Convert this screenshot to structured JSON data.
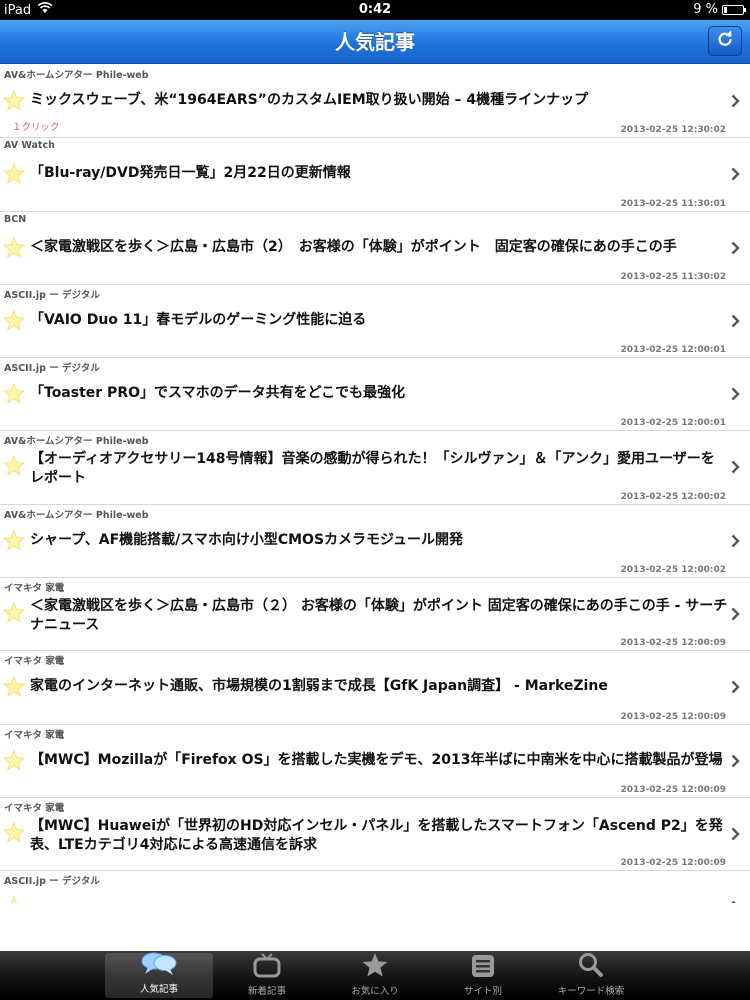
{
  "status": {
    "device": "iPad",
    "time": "0:42",
    "battery": "9 %",
    "battery_level": 0.09
  },
  "nav": {
    "title": "人気記事"
  },
  "articles": [
    {
      "source": "AV&ホームシアター Phile-web",
      "title": "ミックスウェーブ、米“1964EARS”のカスタムIEM取り扱い開始 – 4機種ラインナップ",
      "date": "2013-02-25 12:30:02",
      "clicks": "１クリック"
    },
    {
      "source": "AV Watch",
      "title": "「Blu-ray/DVD発売日一覧」2月22日の更新情報",
      "date": "2013-02-25 11:30:01",
      "clicks": ""
    },
    {
      "source": "BCN",
      "title": "＜家電激戦区を歩く＞広島・広島市（2）　お客様の「体験」がポイント　固定客の確保にあの手この手",
      "date": "2013-02-25 11:30:02",
      "clicks": ""
    },
    {
      "source": "ASCII.jp ー デジタル",
      "title": "「VAIO Duo 11」春モデルのゲーミング性能に迫る",
      "date": "2013-02-25 12:00:01",
      "clicks": ""
    },
    {
      "source": "ASCII.jp ー デジタル",
      "title": "「Toaster PRO」でスマホのデータ共有をどこでも最強化",
      "date": "2013-02-25 12:00:01",
      "clicks": ""
    },
    {
      "source": "AV&ホームシアター Phile-web",
      "title": "【オーディオアクセサリー148号情報】音楽の感動が得られた！「シルヴァン」＆「アンク」愛用ユーザーをレポート",
      "date": "2013-02-25 12:00:02",
      "clicks": ""
    },
    {
      "source": "AV&ホームシアター Phile-web",
      "title": "シャープ、AF機能搭載/スマホ向け小型CMOSカメラモジュール開発",
      "date": "2013-02-25 12:00:02",
      "clicks": ""
    },
    {
      "source": "イマキタ 家電",
      "title": "＜家電激戦区を歩く＞広島・広島市（２） お客様の「体験」がポイント 固定客の確保にあの手この手 - サーチナニュース",
      "date": "2013-02-25 12:00:09",
      "clicks": ""
    },
    {
      "source": "イマキタ 家電",
      "title": "家電のインターネット通販、市場規模の1割弱まで成長【GfK Japan調査】 - MarkeZine",
      "date": "2013-02-25 12:00:09",
      "clicks": ""
    },
    {
      "source": "イマキタ 家電",
      "title": "【MWC】Mozillaが「Firefox OS」を搭載した実機をデモ、2013年半ばに中南米を中心に搭載製品が登場",
      "date": "2013-02-25 12:00:09",
      "clicks": ""
    },
    {
      "source": "イマキタ 家電",
      "title": "【MWC】Huaweiが「世界初のHD対応インセル・パネル」を搭載したスマートフォン「Ascend P2」を発表、LTEカテゴリ4対応による高速通信を訴求",
      "date": "2013-02-25 12:00:09",
      "clicks": ""
    },
    {
      "source": "ASCII.jp ー デジタル",
      "title": "",
      "date": "",
      "clicks": ""
    }
  ],
  "tabs": [
    {
      "label": "人気記事",
      "icon": "speech-bubbles-icon",
      "active": true
    },
    {
      "label": "新着記事",
      "icon": "tv-icon",
      "active": false
    },
    {
      "label": "お気に入り",
      "icon": "star-icon",
      "active": false
    },
    {
      "label": "サイト別",
      "icon": "list-icon",
      "active": false
    },
    {
      "label": "キーワード検索",
      "icon": "search-icon",
      "active": false
    }
  ]
}
